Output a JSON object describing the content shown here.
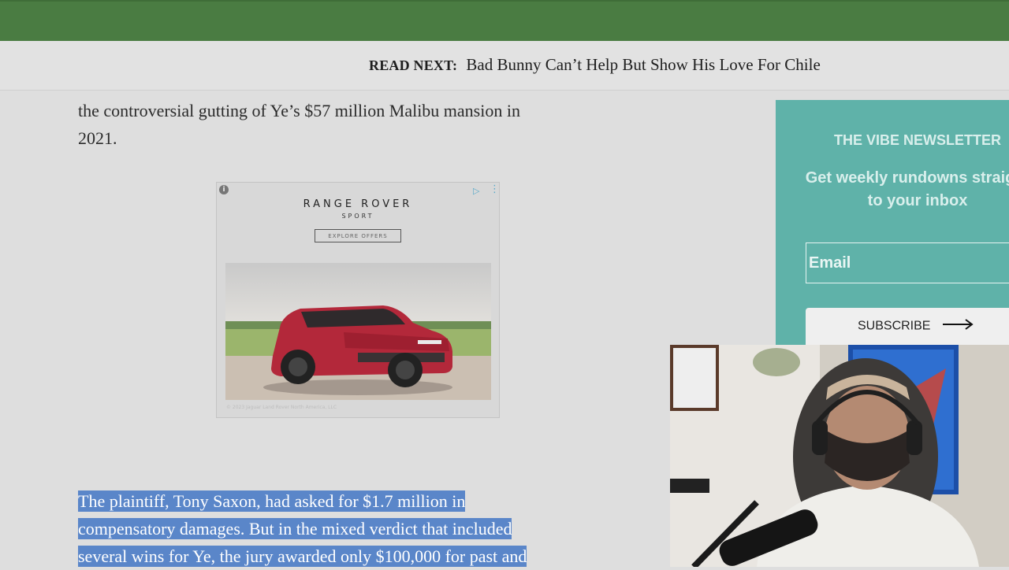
{
  "read_next": {
    "label": "READ NEXT:",
    "headline": "Bad Bunny Can’t Help But Show His Love For Chile"
  },
  "article": {
    "lines_top": [
      "the controversial gutting of Ye’s $57 million Malibu mansion in",
      "2021."
    ],
    "highlighted_lines": [
      "The plaintiff, Tony Saxon, had asked for $1.7 million in",
      "compensatory damages. But in the mixed verdict that included",
      "several wins for Ye, the jury awarded only $100,000 for past and"
    ]
  },
  "ad": {
    "info_icon": "info-icon",
    "brand": "RANGE ROVER",
    "model": "SPORT",
    "cta": "EXPLORE OFFERS",
    "fine_print": "© 2023 Jaguar Land Rover North America, LLC"
  },
  "newsletter": {
    "title": "THE VIBE NEWSLETTER",
    "description": "Get weekly rundowns straight to your inbox",
    "email_placeholder": "Email",
    "subscribe_label": "SUBSCRIBE",
    "background_color": "#5fb2a9"
  },
  "colors": {
    "top_bar": "#4a7c42",
    "selection": "#5a86c9"
  }
}
